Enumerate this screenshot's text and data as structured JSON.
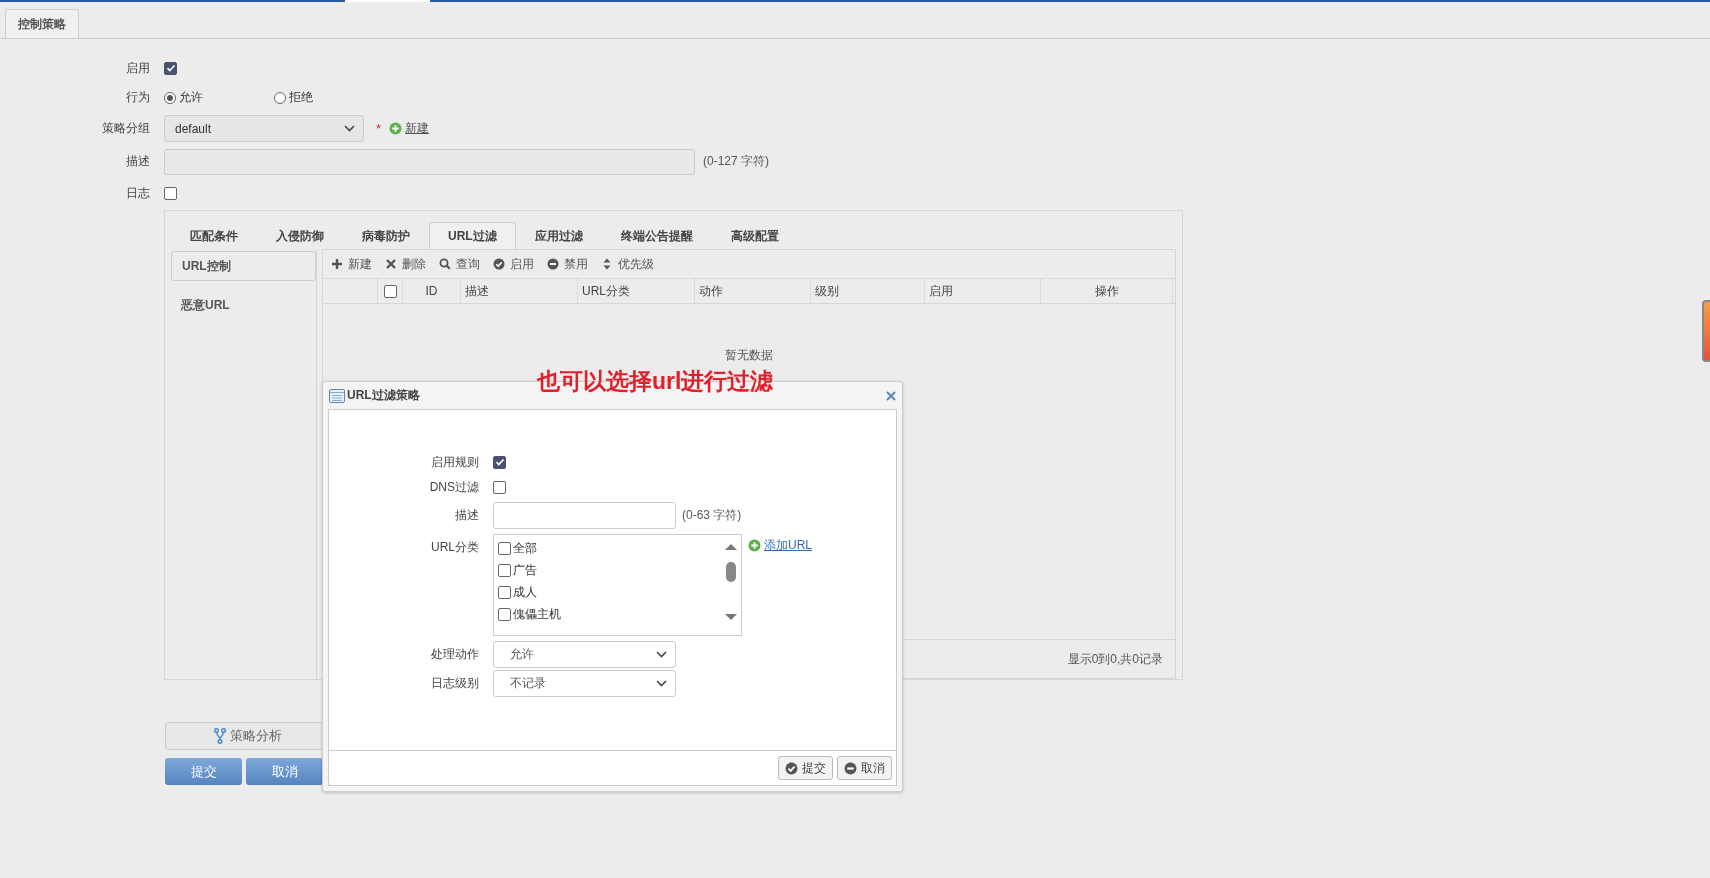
{
  "page_tabs": [
    {
      "label": "控制策略",
      "selected": true
    }
  ],
  "form": {
    "enable": {
      "label": "启用",
      "checked": true
    },
    "action": {
      "label": "行为",
      "options": [
        {
          "label": "允许",
          "selected": true
        },
        {
          "label": "拒绝",
          "selected": false
        }
      ]
    },
    "group": {
      "label": "策略分组",
      "value": "default",
      "required_mark": "*",
      "new_link": "新建"
    },
    "description": {
      "label": "描述",
      "hint": "(0-127 字符)"
    },
    "log": {
      "label": "日志",
      "checked": false
    }
  },
  "policy_tabs": [
    {
      "label": "匹配条件",
      "selected": false
    },
    {
      "label": "入侵防御",
      "selected": false
    },
    {
      "label": "病毒防护",
      "selected": false
    },
    {
      "label": "URL过滤",
      "selected": true
    },
    {
      "label": "应用过滤",
      "selected": false
    },
    {
      "label": "终端公告提醒",
      "selected": false
    },
    {
      "label": "高级配置",
      "selected": false
    }
  ],
  "sub_nav": [
    {
      "label": "URL控制",
      "selected": true
    },
    {
      "label": "恶意URL",
      "selected": false
    }
  ],
  "toolbar": [
    {
      "label": "新建",
      "kind": "plus"
    },
    {
      "label": "删除",
      "kind": "cross"
    },
    {
      "label": "查询",
      "kind": "search"
    },
    {
      "label": "启用",
      "kind": "check"
    },
    {
      "label": "禁用",
      "kind": "minus"
    },
    {
      "label": "优先级",
      "kind": "sort"
    }
  ],
  "table": {
    "select_all_checked": false,
    "columns": [
      "ID",
      "描述",
      "URL分类",
      "动作",
      "级别",
      "启用",
      "操作"
    ],
    "empty_text": "暂无数据",
    "footer": "显示0到0,共0记录"
  },
  "analysis_button": "策略分析",
  "buttons": [
    "提交",
    "取消"
  ],
  "annotation": "也可以选择url进行过滤",
  "dialog": {
    "title": "URL过滤策略",
    "enable_rule": {
      "label": "启用规则",
      "checked": true
    },
    "dns_filter": {
      "label": "DNS过滤",
      "checked": false
    },
    "description": {
      "label": "描述",
      "hint": "(0-63 字符)"
    },
    "url_category": {
      "label": "URL分类",
      "add_link": "添加URL",
      "items": [
        {
          "label": "全部",
          "checked": false
        },
        {
          "label": "广告",
          "checked": false
        },
        {
          "label": "成人",
          "checked": false
        },
        {
          "label": "傀儡主机",
          "checked": false
        }
      ]
    },
    "action": {
      "label": "处理动作",
      "value": "允许"
    },
    "log_level": {
      "label": "日志级别",
      "value": "不记录"
    },
    "buttons": [
      {
        "label": "提交",
        "kind": "check"
      },
      {
        "label": "取消",
        "kind": "minus"
      }
    ]
  }
}
